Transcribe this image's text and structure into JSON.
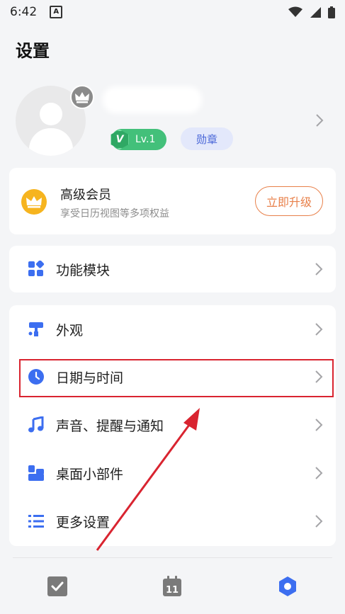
{
  "status_bar": {
    "time": "6:42",
    "notif_icon": "a-icon",
    "icons": [
      "wifi-icon",
      "signal-icon",
      "battery-icon"
    ]
  },
  "page": {
    "title": "设置"
  },
  "profile": {
    "level": "Lv.1",
    "level_mark": "V",
    "medal_label": "勋章",
    "colors": {
      "level": "#43c07a",
      "medal_bg": "#e3e8fb",
      "medal_text": "#4a67d8"
    }
  },
  "vip": {
    "title": "高级会员",
    "subtitle": "享受日历视图等多项权益",
    "button_label": "立即升级",
    "colors": {
      "icon": "#f6b41f",
      "button": "#e8804a"
    }
  },
  "module_row": {
    "label": "功能模块",
    "icon": "grid-icon"
  },
  "settings_rows": [
    {
      "label": "外观",
      "icon": "paint-roller-icon"
    },
    {
      "label": "日期与时间",
      "icon": "clock-icon"
    },
    {
      "label": "声音、提醒与通知",
      "icon": "music-note-icon"
    },
    {
      "label": "桌面小部件",
      "icon": "widgets-icon"
    },
    {
      "label": "更多设置",
      "icon": "list-icon"
    }
  ],
  "tabbar": {
    "tabs": [
      {
        "name": "tasks",
        "icon": "checkbox-icon"
      },
      {
        "name": "calendar",
        "icon": "calendar-icon",
        "day": "11"
      },
      {
        "name": "settings",
        "icon": "hexagon-settings-icon",
        "active": true
      }
    ]
  },
  "colors": {
    "accent": "#3c6ef0",
    "annotation": "#d92430"
  }
}
